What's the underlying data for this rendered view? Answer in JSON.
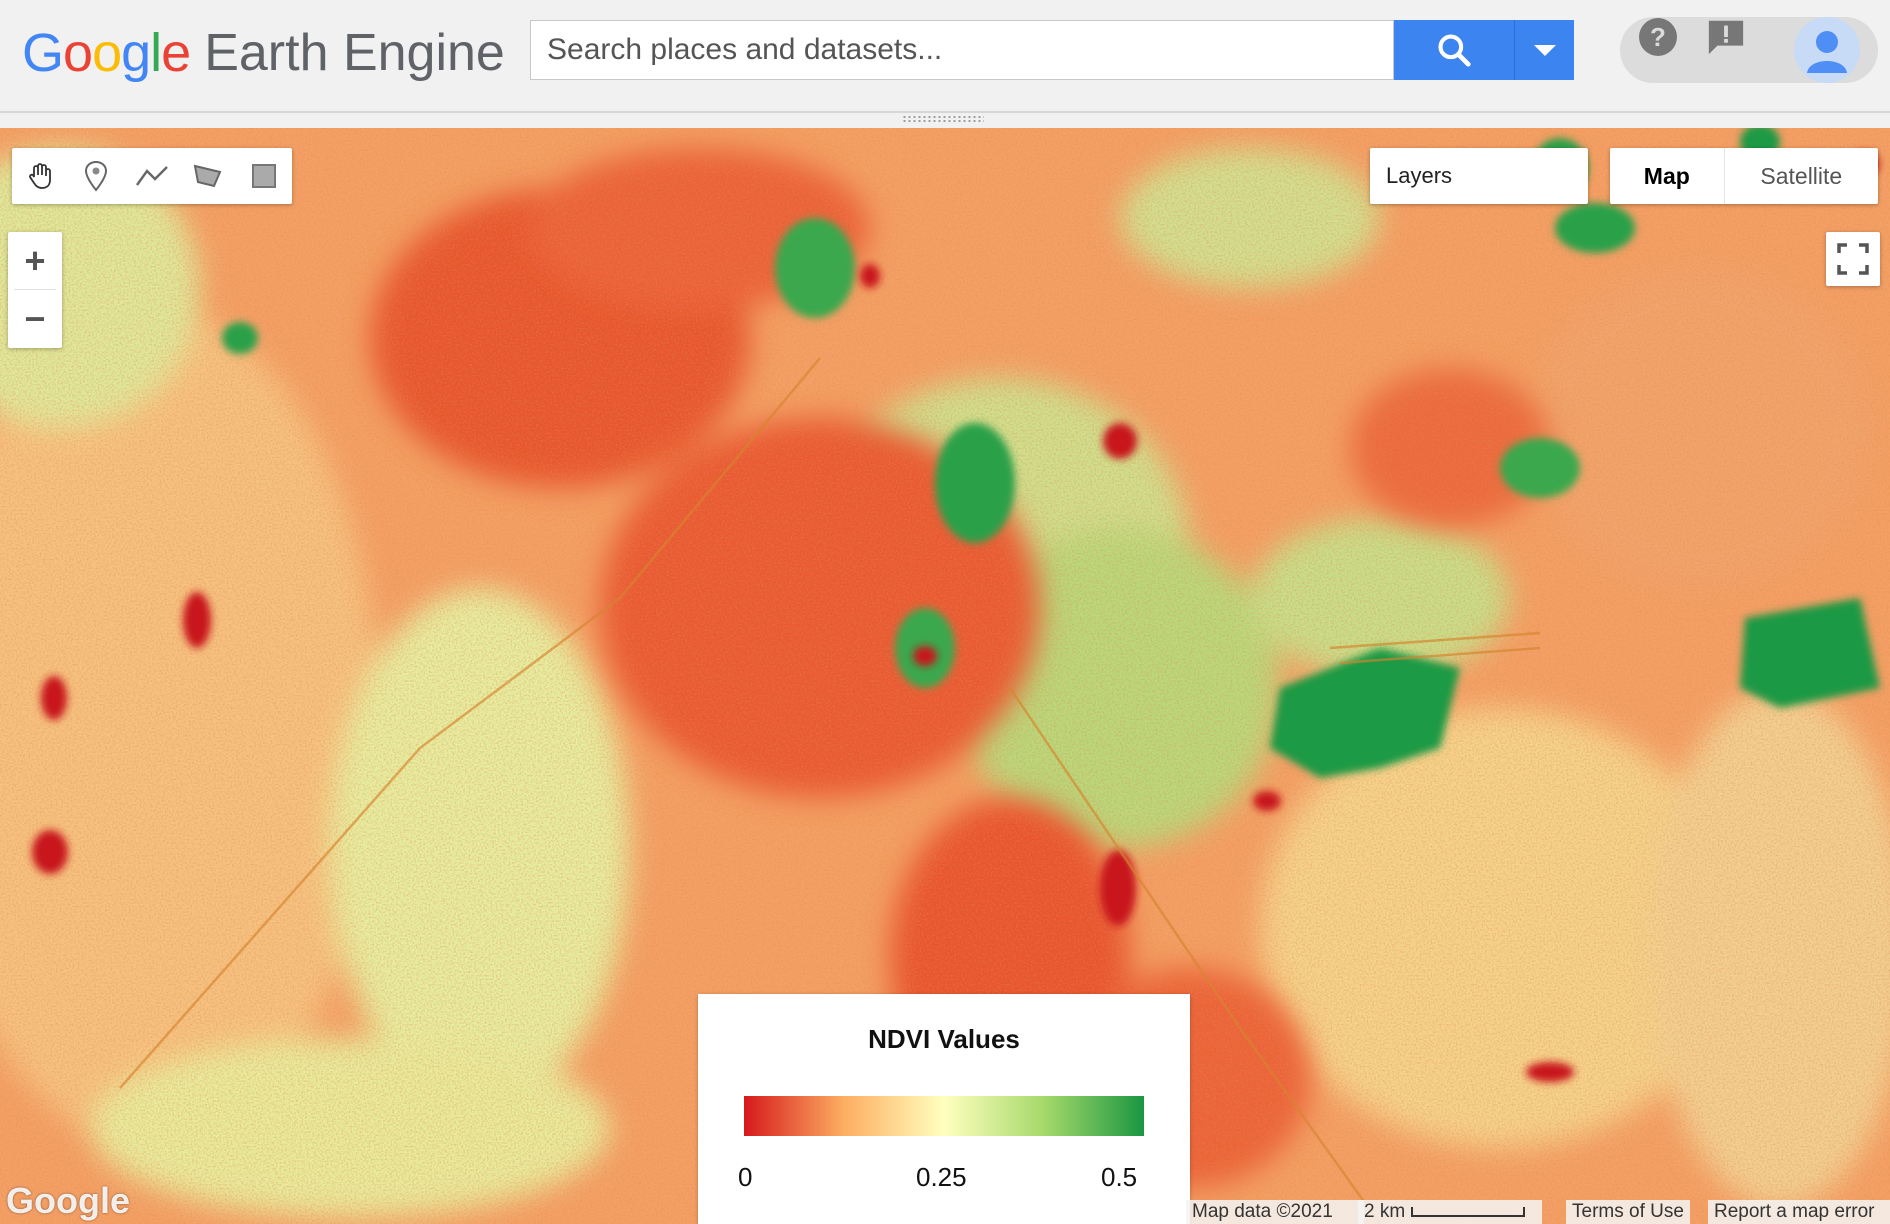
{
  "header": {
    "logo_google": "Google",
    "logo_product": "Earth Engine",
    "search_placeholder": "Search places and datasets...",
    "icons": [
      "search-icon",
      "chevron-down-icon",
      "help-icon",
      "feedback-icon",
      "account-icon"
    ],
    "colors": {
      "search_button": "#3c84f0",
      "google_blue": "#4285F4",
      "google_red": "#EA4335",
      "google_yellow": "#FBBC05",
      "google_green": "#34A853"
    }
  },
  "map": {
    "drawing_tools": [
      {
        "name": "pan",
        "icon": "hand-icon"
      },
      {
        "name": "point",
        "icon": "marker-icon"
      },
      {
        "name": "line",
        "icon": "line-icon"
      },
      {
        "name": "polygon",
        "icon": "polygon-icon"
      },
      {
        "name": "rectangle",
        "icon": "rectangle-icon"
      }
    ],
    "zoom_in": "+",
    "zoom_out": "−",
    "layers_label": "Layers",
    "maptype": {
      "map": "Map",
      "satellite": "Satellite",
      "selected": "Map"
    },
    "fullscreen_icon": "fullscreen-icon",
    "legend": {
      "title": "NDVI Values",
      "min": "0",
      "mid": "0.25",
      "max": "0.5",
      "palette": [
        "#d7191c",
        "#fdae61",
        "#ffffbf",
        "#a6d96a",
        "#1a9641"
      ]
    },
    "watermark": "Google",
    "attribution": {
      "map_data": "Map data ©2021",
      "scale": "2 km",
      "terms": "Terms of Use",
      "report": "Report a map error"
    }
  }
}
